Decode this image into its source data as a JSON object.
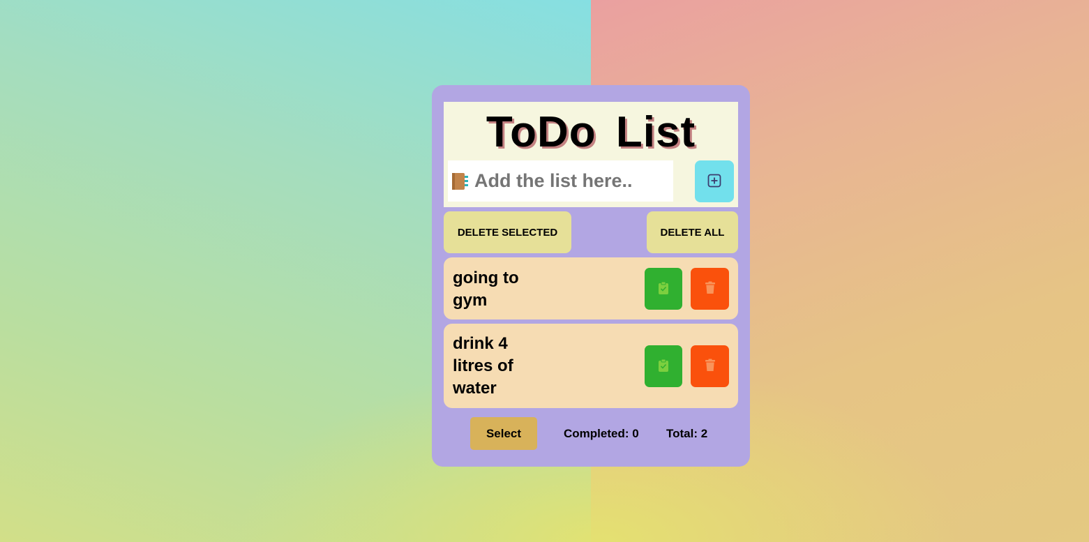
{
  "app": {
    "title": "ToDo List"
  },
  "input": {
    "placeholder": "Add the list here..",
    "value": "",
    "icon": "notebook-icon"
  },
  "add_button": {
    "icon": "plus-square-icon"
  },
  "actions": {
    "delete_selected": "DELETE SELECTED",
    "delete_all": "DELETE ALL"
  },
  "tasks": [
    {
      "text": "going to gym",
      "done_icon": "clipboard-check-icon",
      "delete_icon": "trash-icon"
    },
    {
      "text": "drink 4 litres of water",
      "done_icon": "clipboard-check-icon",
      "delete_icon": "trash-icon"
    }
  ],
  "footer": {
    "select_label": "Select",
    "completed": "Completed: 0",
    "total": "Total: 2"
  },
  "colors": {
    "card": "#b2a6e3",
    "header": "#f6f6df",
    "add_button": "#72e0ec",
    "action_button": "#e6e098",
    "task_bg": "#f6dcb3",
    "done_button": "#30b030",
    "trash_button": "#fa510c",
    "select_button": "#d8b25a"
  }
}
